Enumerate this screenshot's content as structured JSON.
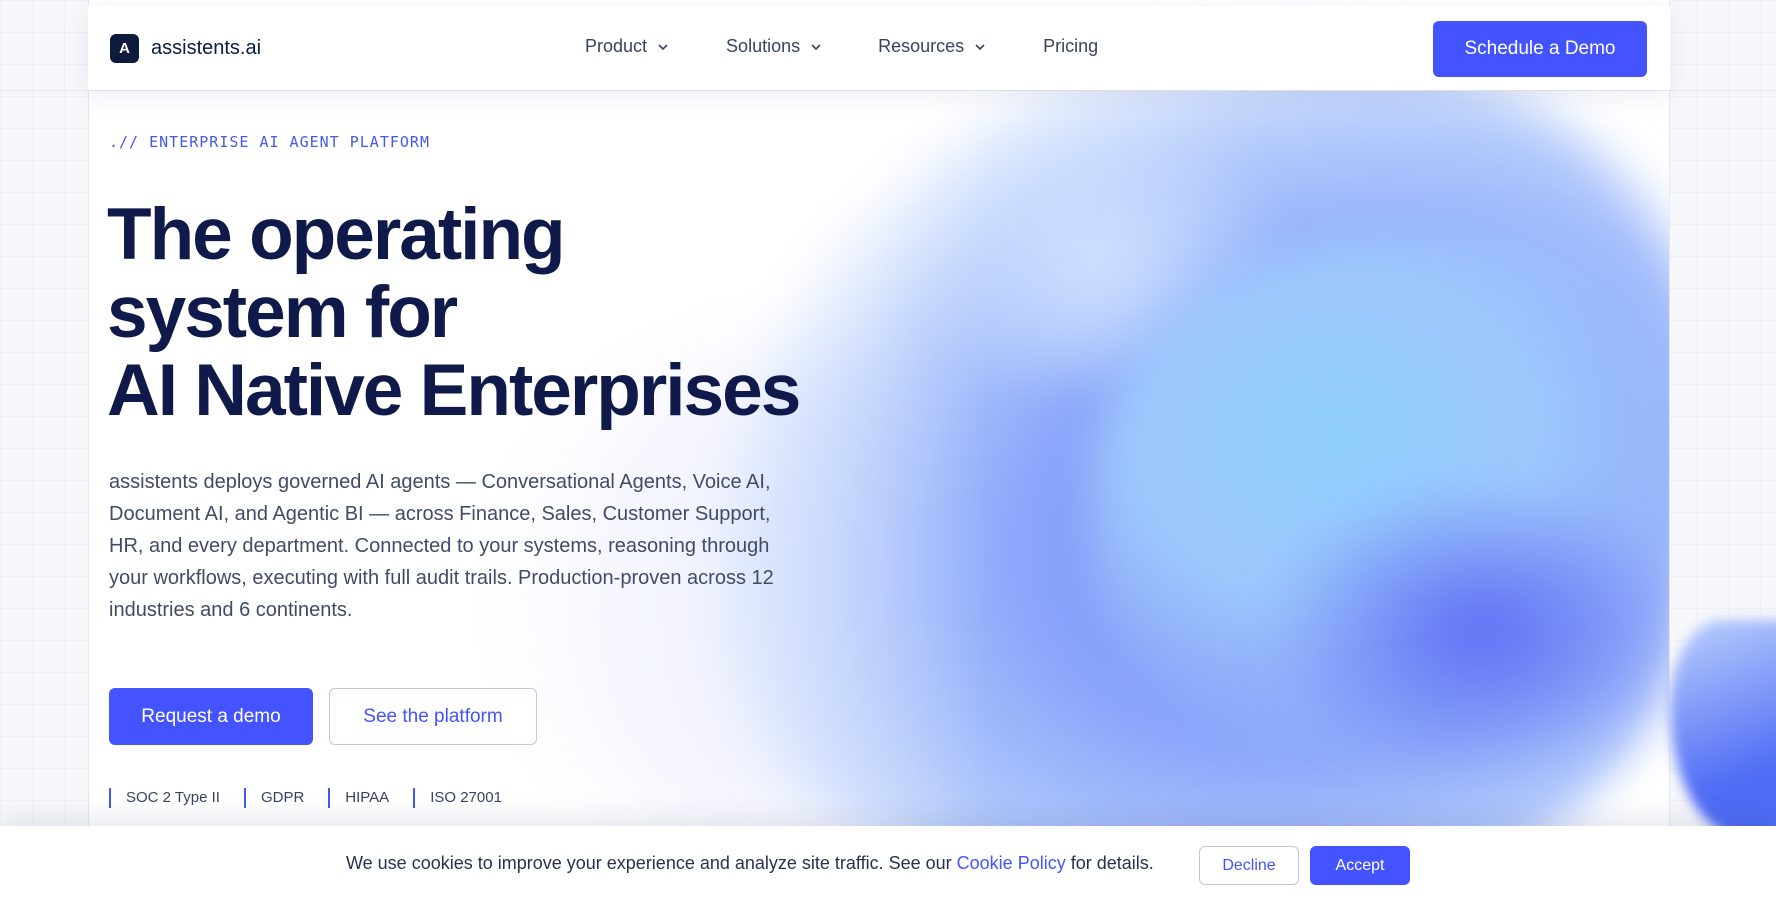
{
  "brand": {
    "logo_letter": "A",
    "name": "assistents.ai"
  },
  "nav": {
    "items": [
      {
        "label": "Product",
        "icon": "chevron-down-icon"
      },
      {
        "label": "Solutions",
        "icon": "chevron-down-icon"
      },
      {
        "label": "Resources",
        "icon": "chevron-down-icon"
      },
      {
        "label": "Pricing"
      }
    ],
    "cta_label": "Schedule a Demo"
  },
  "hero": {
    "eyebrow": ".// ENTERPRISE AI AGENT PLATFORM",
    "headline_lines": [
      "The operating",
      "system for",
      "AI Native Enterprises"
    ],
    "lede": "assistents deploys governed AI agents — Conversational Agents, Voice AI, Document AI, and Agentic BI — across Finance, Sales, Customer Support, HR, and every department. Connected to your systems, reasoning through your workflows, executing with full audit trails. Production-proven across 12 industries and 6 continents.",
    "primary_button": "Request a demo",
    "secondary_button": "See the platform",
    "badges": [
      "SOC 2 Type II",
      "GDPR",
      "HIPAA",
      "ISO 27001"
    ]
  },
  "cookie_banner": {
    "text_before": "We use cookies to improve your experience and analyze site traffic. See our ",
    "link_text": "Cookie Policy",
    "text_after": " for details.",
    "decline_label": "Decline",
    "accept_label": "Accept"
  },
  "colors": {
    "accent": "#4353ff",
    "heading": "#0f1a4a",
    "eyebrow": "#4658ee",
    "logo_bg": "#0d1b3e"
  }
}
